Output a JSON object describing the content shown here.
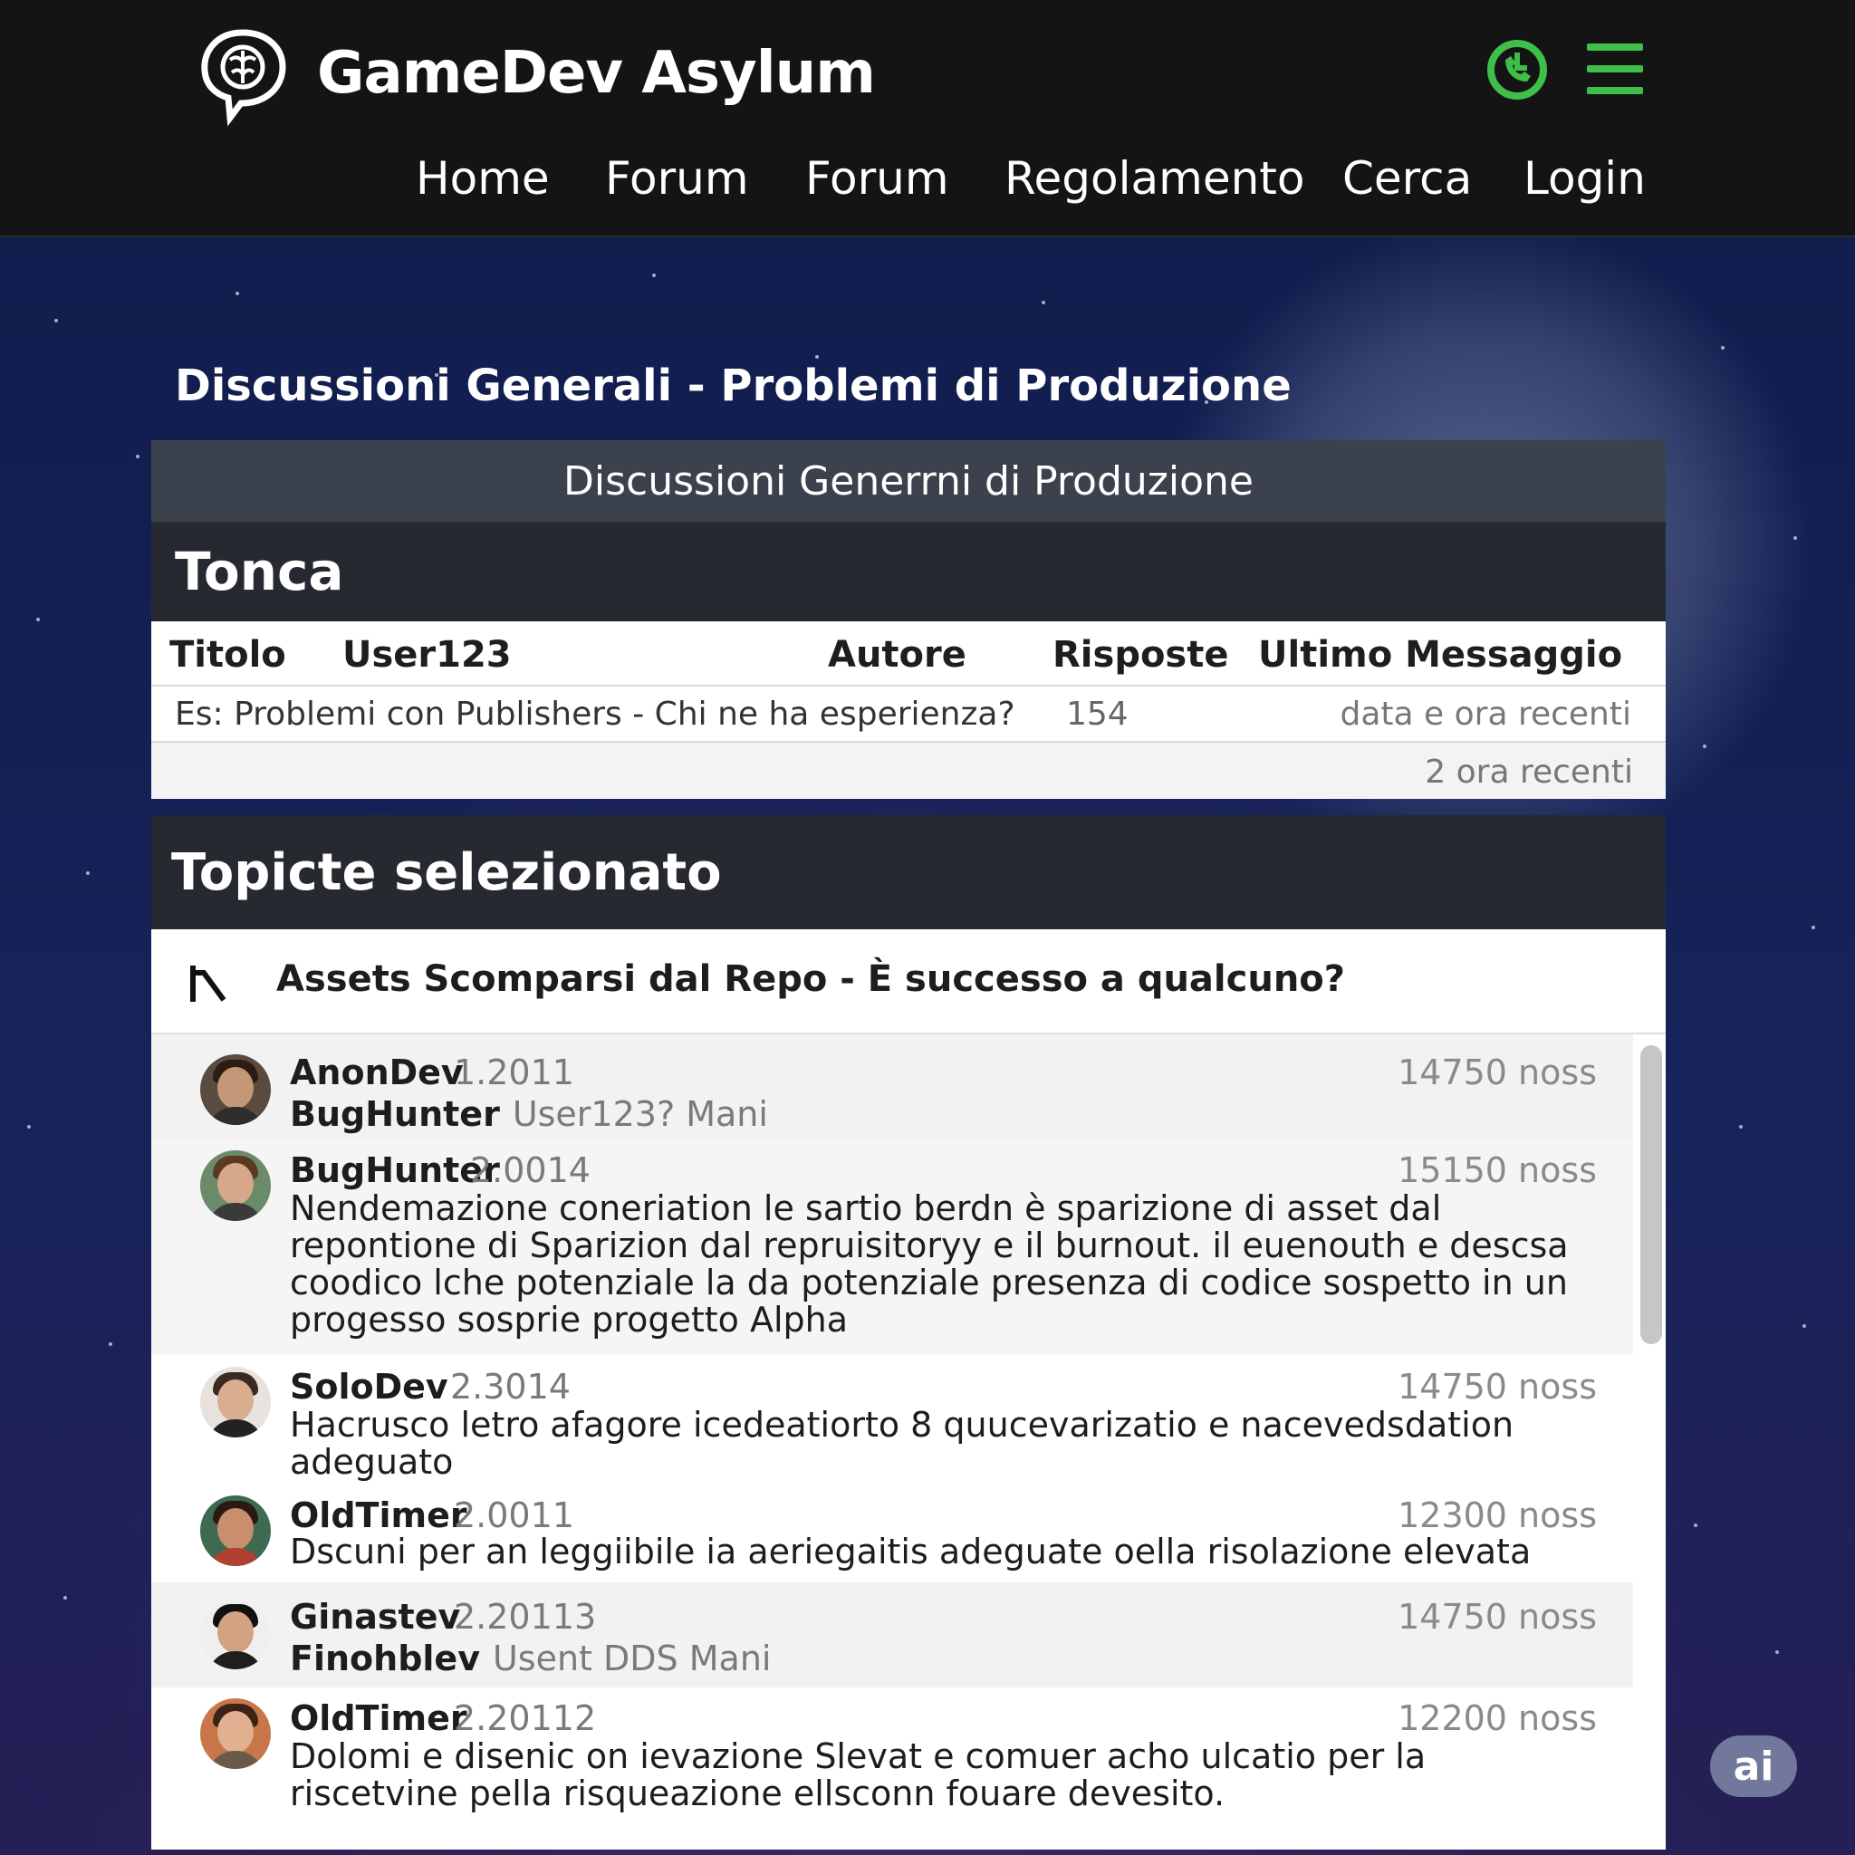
{
  "header": {
    "brand": "GameDev Asylum",
    "logo_icon": "brain-head-icon",
    "accent_color": "#3fbf4a",
    "nav": [
      {
        "label": "Home"
      },
      {
        "label": "Forum"
      },
      {
        "label": "Forum"
      },
      {
        "label": "Regolamento"
      },
      {
        "label": "Cerca"
      },
      {
        "label": "Login"
      }
    ]
  },
  "page": {
    "title": "Discussioni Generali - Problemi di Produzione"
  },
  "panel": {
    "heading": "Discussioni Generrni di Produzione",
    "section_label": "Tonca",
    "columns": {
      "titolo": "Titolo",
      "user": "User123",
      "autore": "Autore",
      "risposte": "Risposte",
      "ultimo": "Ultimo Messaggio"
    },
    "row": {
      "title": "Es: Problemi con Publishers - Chi ne ha esperienza?",
      "replies": "154",
      "last": "data e ora recenti"
    },
    "row2": {
      "last": "2 ora recenti"
    }
  },
  "topic": {
    "section_label": "Topicte selezionato",
    "title": "Assets Scomparsi dal Repo - È successo a qualcuno?"
  },
  "posts": [
    {
      "user": "AnonDev",
      "date": "1.2011",
      "count": "14750 noss",
      "user2": "BugHunter",
      "sub": "User123? Mani"
    },
    {
      "user": "BugHunter",
      "date": "2.0014",
      "count": "15150 noss",
      "text": "Nendemazione coneriation le sartio berdn è sparizione di asset dal repontione di Sparizion dal repruisitoryy e il burnout. il euenouth e descsa coodico lche potenziale la da potenziale presenza di codice sospetto in un progesso sosprie progetto Alpha"
    },
    {
      "user": "SoloDev",
      "date": "2.3014",
      "count": "14750 noss",
      "text": "Hacrusco letro afagore icedeatiorto 8 quucevarizatio e nacevedsdation adeguato"
    },
    {
      "user": "OldTimer",
      "date": "2.0011",
      "count": "12300 noss",
      "text": "Dscuni per an leggiibile ia aeriegaitis adeguate oella risolazione elevata"
    },
    {
      "user": "Ginastev",
      "date": "2.20113",
      "count": "14750 noss",
      "user2": "Finohblev",
      "sub": "Usent DDS Mani"
    },
    {
      "user": "OldTimer",
      "date": "2.20112",
      "count": "12200 noss",
      "text": "Dolomi e disenic on ievazione Slevat e comuer acho ulcatio per la riscetvine pella risqueazione ellsconn fouare devesito."
    }
  ],
  "badge": "ai"
}
